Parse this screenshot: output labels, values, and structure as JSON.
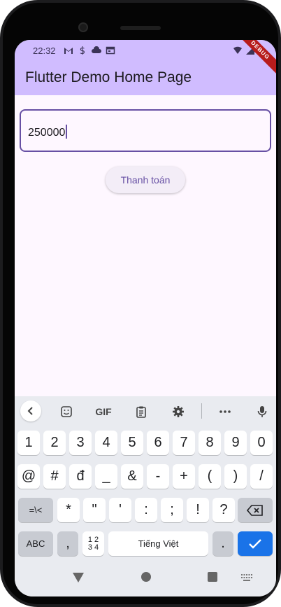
{
  "status_bar": {
    "time": "22:32"
  },
  "app_bar": {
    "title": "Flutter Demo Home Page",
    "color": "#d0bcff",
    "debug_banner": "DEBUG"
  },
  "amount_field": {
    "value": "250000",
    "border_color": "#6750a4"
  },
  "pay_button": {
    "label": "Thanh toán"
  },
  "keyboard": {
    "toolbar": {
      "gif_label": "GIF"
    },
    "row1": [
      "1",
      "2",
      "3",
      "4",
      "5",
      "6",
      "7",
      "8",
      "9",
      "0"
    ],
    "row2": [
      "@",
      "#",
      "đ",
      "_",
      "&",
      "-",
      "+",
      "(",
      ")",
      "/"
    ],
    "row3": {
      "shift_label": "=\\<",
      "keys": [
        "*",
        "\"",
        "'",
        ":",
        ";",
        "!",
        "?"
      ]
    },
    "row4": {
      "abc_label": "ABC",
      "comma": ",",
      "numpad_label": "1 2\n3 4",
      "space_label": "Tiếng Việt",
      "period": "."
    },
    "accent_color": "#1a73e8"
  }
}
